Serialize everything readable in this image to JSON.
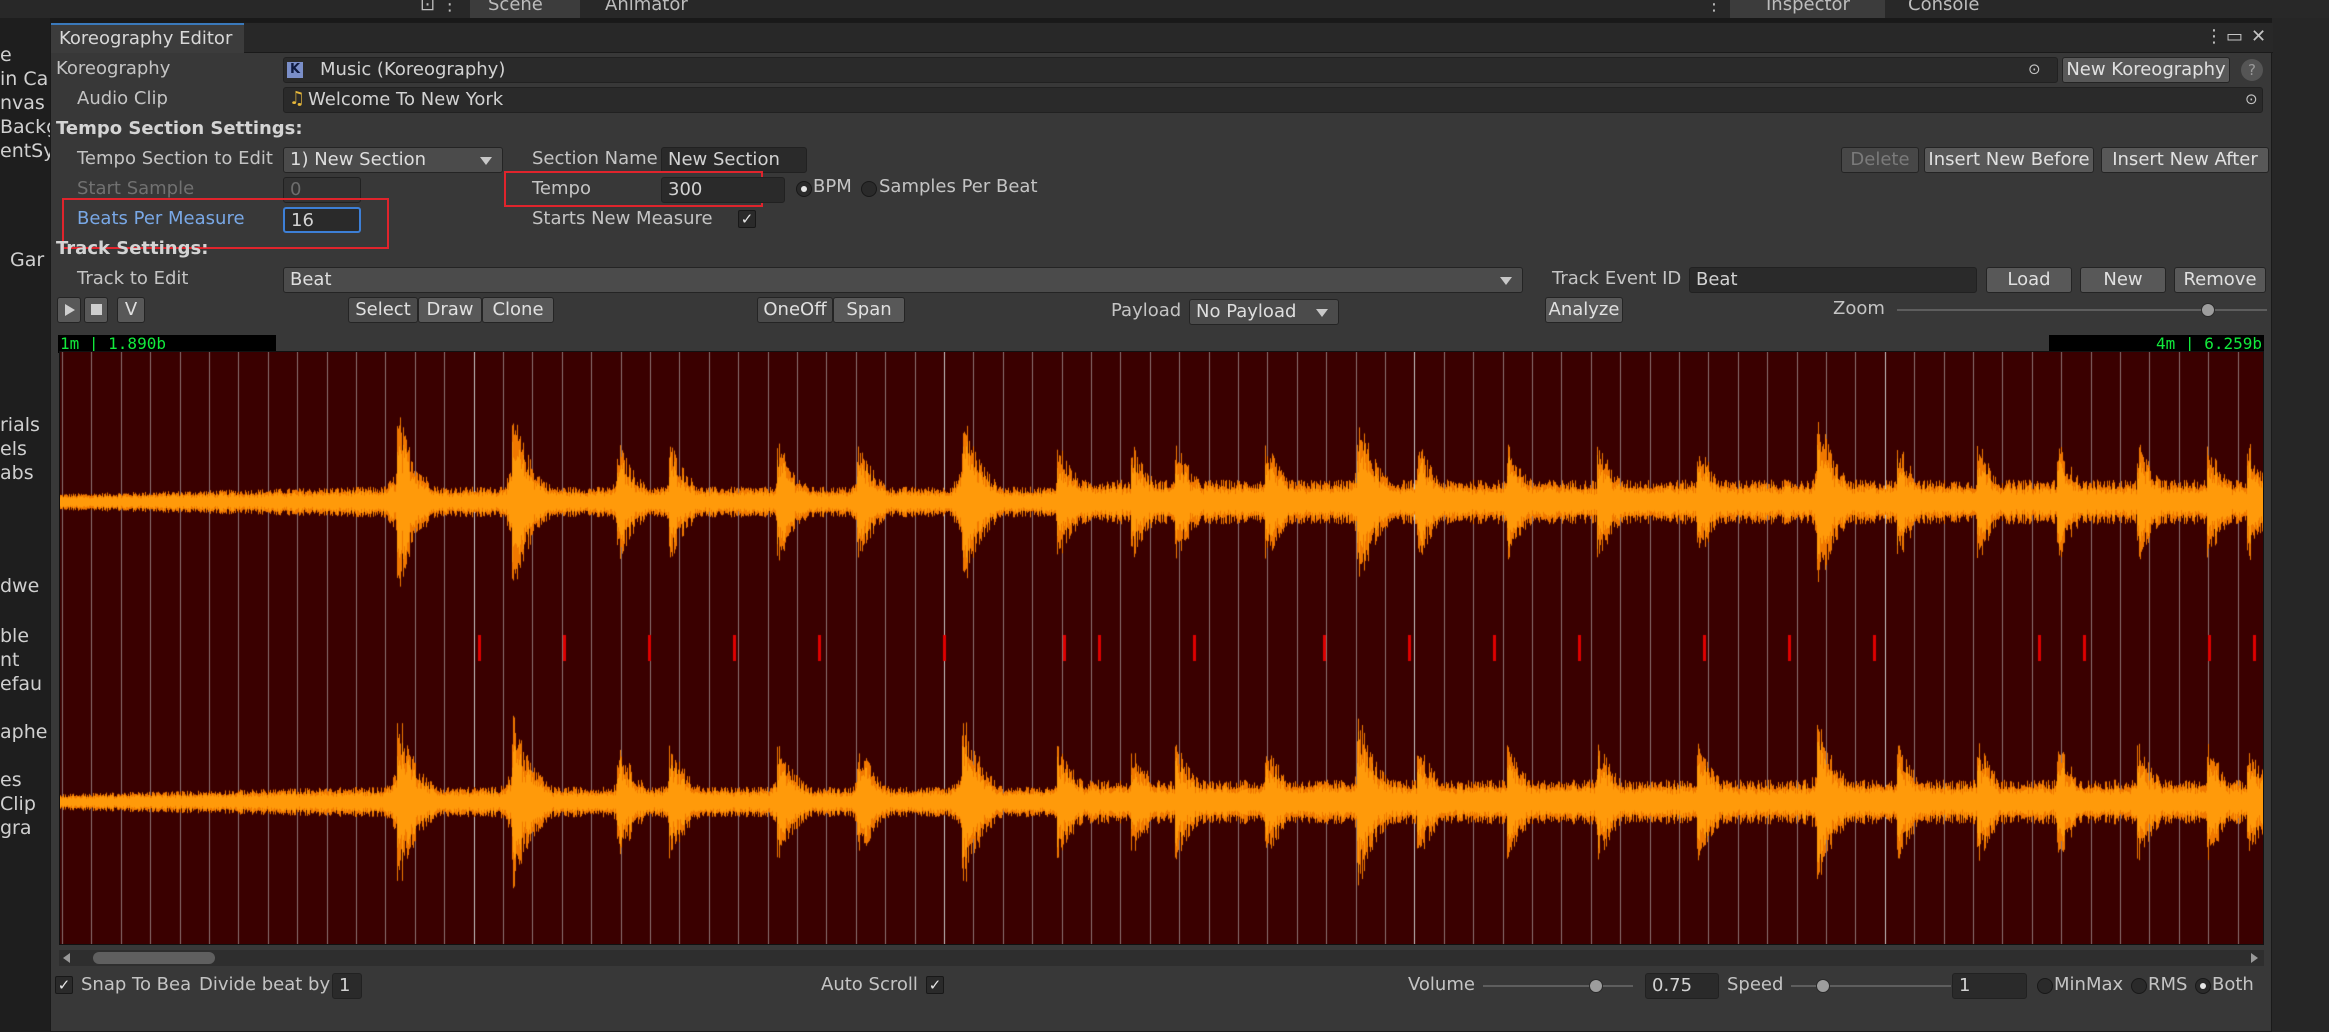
{
  "background": {
    "scene_tab": "Scene",
    "animator_tab": "Animator",
    "inspector_tab": "Inspector",
    "console_tab": "Console",
    "hierarchy_fragments": [
      "e",
      "in Ca",
      "nvas",
      "Backg",
      "entSy",
      "Gar",
      "rials",
      "els",
      "abs",
      "dwe",
      "ble",
      "nt",
      "efau",
      "aphe",
      "es",
      "Clip",
      "gra"
    ]
  },
  "window": {
    "title": "Koreography Editor"
  },
  "koreography": {
    "label": "Koreography",
    "value": "Music (Koreography)",
    "new_button": "New Koreography",
    "help": "?"
  },
  "audio_clip": {
    "label": "Audio Clip",
    "value": "Welcome To New York"
  },
  "tempo_section": {
    "header": "Tempo Section Settings:",
    "to_edit_label": "Tempo Section to Edit",
    "to_edit_value": "1) New Section",
    "section_name_label": "Section Name",
    "section_name_value": "New Section",
    "delete_button": "Delete",
    "insert_before_button": "Insert New Before",
    "insert_after_button": "Insert New After",
    "start_sample_label": "Start Sample",
    "start_sample_value": "0",
    "tempo_label": "Tempo",
    "tempo_value": "300",
    "bpm_label": "BPM",
    "samples_per_beat_label": "Samples Per Beat",
    "beats_per_measure_label": "Beats Per Measure",
    "beats_per_measure_value": "16",
    "starts_new_measure_label": "Starts New Measure"
  },
  "track": {
    "header": "Track Settings:",
    "to_edit_label": "Track to Edit",
    "to_edit_value": "Beat",
    "event_id_label": "Track Event ID",
    "event_id_value": "Beat",
    "load_button": "Load",
    "new_button": "New",
    "remove_button": "Remove"
  },
  "toolbar": {
    "v_button": "V",
    "select_button": "Select",
    "draw_button": "Draw",
    "clone_button": "Clone",
    "oneoff_button": "OneOff",
    "span_button": "Span",
    "payload_label": "Payload",
    "payload_value": "No Payload",
    "analyze_button": "Analyze",
    "zoom_label": "Zoom",
    "zoom_level": 0.84
  },
  "waveform": {
    "start_readout": "1m | 1.890b",
    "end_readout": "4m | 6.259b",
    "colors": {
      "background": "#3a0000",
      "wave": "#ff9a0a",
      "wave_dark": "#f07800",
      "beat_line": "#d0d0d0",
      "event": "#e00000"
    }
  },
  "bottom": {
    "snap_label": "Snap To Bea",
    "divide_label": "Divide beat by",
    "divide_value": "1",
    "auto_scroll_label": "Auto Scroll",
    "volume_label": "Volume",
    "volume_value": "0.75",
    "speed_label": "Speed",
    "speed_value": "1",
    "minmax_label": "MinMax",
    "rms_label": "RMS",
    "both_label": "Both"
  }
}
